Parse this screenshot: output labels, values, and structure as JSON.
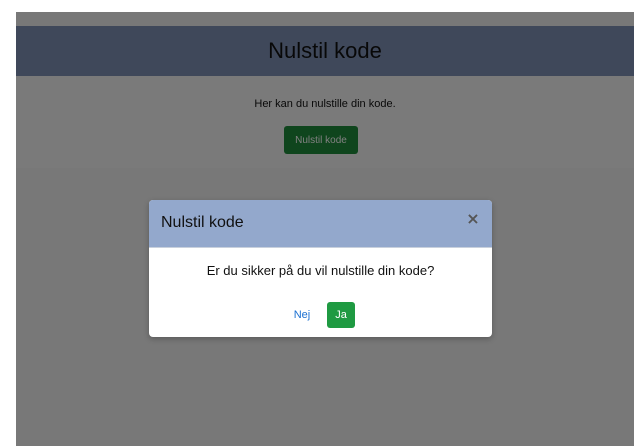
{
  "page": {
    "title": "Nulstil kode",
    "description": "Her kan du nulstille din kode.",
    "reset_button_label": "Nulstil kode"
  },
  "modal": {
    "title": "Nulstil kode",
    "close_glyph": "×",
    "question": "Er du sikker på du vil nulstille din kode?",
    "no_label": "Nej",
    "yes_label": "Ja"
  },
  "colors": {
    "header_background": "#7e90b4",
    "modal_header_background": "#93a8cc",
    "primary_button": "#1f9a42",
    "link": "#1a6fd1"
  },
  "icons": {
    "modal_close": "close-icon"
  }
}
